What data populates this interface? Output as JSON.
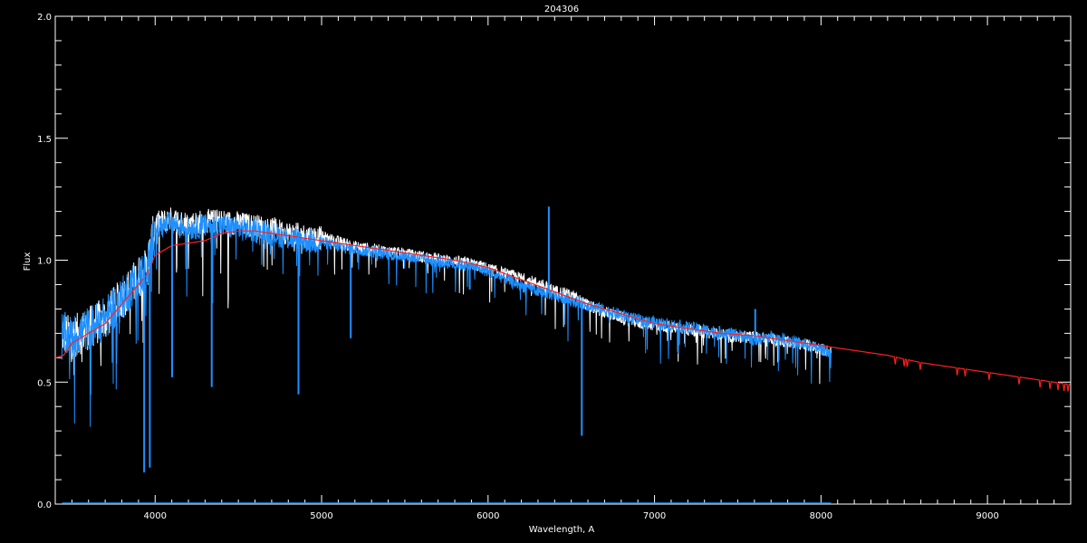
{
  "chart_data": {
    "type": "line",
    "title": "204306",
    "xlabel": "Wavelength, A",
    "ylabel": "Flux",
    "xlim": [
      3400,
      9500
    ],
    "ylim": [
      0.0,
      2.0
    ],
    "x_ticks": [
      "4000",
      "5000",
      "6000",
      "7000",
      "8000",
      "9000"
    ],
    "y_ticks": [
      "0.0",
      "0.5",
      "1.0",
      "1.5",
      "2.0"
    ],
    "grid": false,
    "legend": "none",
    "colors": {
      "background": "#000000",
      "axes": "#ffffff",
      "white_series": "#ffffff",
      "blue_series": "#1e90ff",
      "red_series": "#ff2020"
    },
    "series": [
      {
        "color": "#ffffff",
        "x": [
          3440,
          3500,
          3600,
          3700,
          3800,
          3900,
          3950,
          4000,
          4100,
          4200,
          4300,
          4400,
          4500,
          4600,
          4700,
          4800,
          4900,
          5000,
          5100,
          5200,
          5300,
          5400,
          5500,
          5600,
          5700,
          5800,
          5900,
          6000,
          6100,
          6200,
          6300,
          6400,
          6500,
          6600,
          6700,
          6800,
          6900,
          7000,
          7100,
          7200,
          7300,
          7400,
          7500,
          7600,
          7700,
          7800,
          7900,
          8000,
          8060
        ],
        "y": [
          0.72,
          0.7,
          0.74,
          0.78,
          0.86,
          0.95,
          0.98,
          1.16,
          1.18,
          1.16,
          1.17,
          1.17,
          1.16,
          1.15,
          1.14,
          1.12,
          1.11,
          1.1,
          1.08,
          1.06,
          1.05,
          1.04,
          1.03,
          1.02,
          1.01,
          1.0,
          0.99,
          0.97,
          0.95,
          0.93,
          0.91,
          0.88,
          0.86,
          0.82,
          0.79,
          0.77,
          0.75,
          0.74,
          0.73,
          0.72,
          0.71,
          0.7,
          0.69,
          0.69,
          0.68,
          0.67,
          0.66,
          0.64,
          0.63
        ]
      },
      {
        "color": "#1e90ff",
        "x": [
          3440,
          3500,
          3600,
          3700,
          3800,
          3900,
          3950,
          4000,
          4100,
          4200,
          4300,
          4400,
          4500,
          4600,
          4700,
          4800,
          4900,
          5000,
          5100,
          5200,
          5300,
          5400,
          5500,
          5600,
          5700,
          5800,
          5900,
          6000,
          6100,
          6200,
          6300,
          6400,
          6500,
          6600,
          6700,
          6800,
          6900,
          7000,
          7100,
          7200,
          7300,
          7400,
          7500,
          7600,
          7700,
          7800,
          7900,
          8000,
          8060
        ],
        "y": [
          0.72,
          0.7,
          0.74,
          0.78,
          0.86,
          0.95,
          0.98,
          1.14,
          1.16,
          1.14,
          1.15,
          1.15,
          1.14,
          1.13,
          1.12,
          1.1,
          1.09,
          1.08,
          1.06,
          1.05,
          1.04,
          1.03,
          1.02,
          1.01,
          1.0,
          0.99,
          0.98,
          0.96,
          0.93,
          0.9,
          0.88,
          0.86,
          0.84,
          0.82,
          0.8,
          0.78,
          0.76,
          0.75,
          0.74,
          0.73,
          0.72,
          0.71,
          0.7,
          0.68,
          0.69,
          0.68,
          0.66,
          0.64,
          0.63
        ]
      },
      {
        "color": "#ff2020",
        "x": [
          3400,
          3450,
          3500,
          3600,
          3700,
          3800,
          3900,
          3950,
          4000,
          4100,
          4200,
          4300,
          4400,
          4500,
          4600,
          4700,
          4800,
          4900,
          5000,
          5200,
          5400,
          5600,
          5800,
          6000,
          6200,
          6400,
          6600,
          6800,
          7000,
          7200,
          7400,
          7600,
          7800,
          8000,
          8200,
          8400,
          8600,
          8800,
          9000,
          9200,
          9400,
          9500
        ],
        "y": [
          0.6,
          0.61,
          0.66,
          0.7,
          0.74,
          0.82,
          0.9,
          0.94,
          1.02,
          1.06,
          1.07,
          1.08,
          1.11,
          1.12,
          1.12,
          1.11,
          1.1,
          1.09,
          1.08,
          1.06,
          1.04,
          1.02,
          1.0,
          0.97,
          0.92,
          0.87,
          0.82,
          0.78,
          0.74,
          0.72,
          0.7,
          0.69,
          0.67,
          0.65,
          0.63,
          0.61,
          0.58,
          0.56,
          0.54,
          0.52,
          0.5,
          0.49
        ]
      }
    ],
    "absorption_lines": [
      {
        "x": 3934,
        "y": 0.13
      },
      {
        "x": 3968,
        "y": 0.15
      },
      {
        "x": 4102,
        "y": 0.52
      },
      {
        "x": 4340,
        "y": 0.48
      },
      {
        "x": 4861,
        "y": 0.45
      },
      {
        "x": 5175,
        "y": 0.68
      },
      {
        "x": 5890,
        "y": 0.88
      },
      {
        "x": 6563,
        "y": 0.28
      }
    ],
    "emission_spikes": [
      {
        "x": 6365,
        "y": 1.22
      },
      {
        "x": 7605,
        "y": 0.8
      }
    ],
    "baseline": {
      "x": [
        3440,
        8060
      ],
      "y": [
        0.0,
        0.0
      ]
    }
  }
}
